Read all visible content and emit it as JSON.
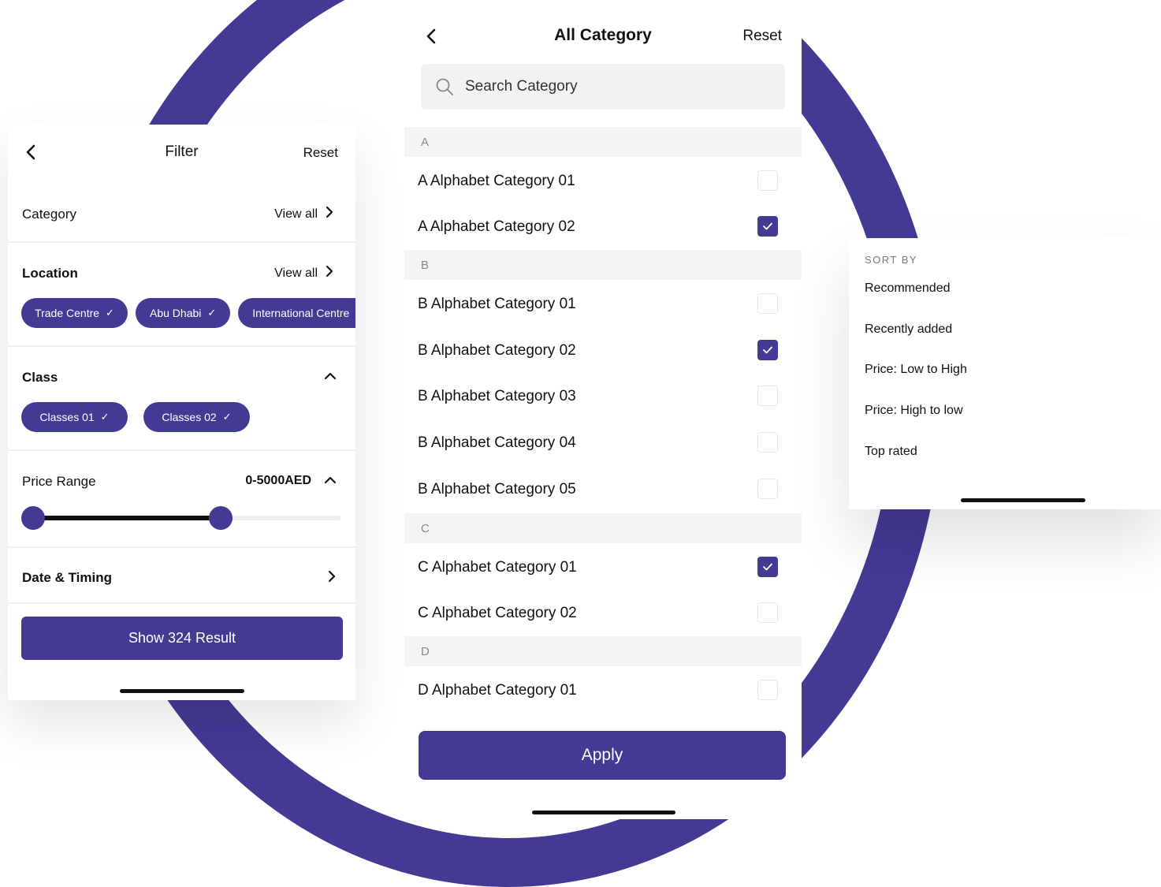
{
  "colors": {
    "accent": "#433a94",
    "text": "#111111",
    "muted": "#888888",
    "divider": "#f0f0f3"
  },
  "filter": {
    "title": "Filter",
    "reset": "Reset",
    "category": {
      "label": "Category",
      "view_all": "View all"
    },
    "location": {
      "label": "Location",
      "view_all": "View all",
      "chips": [
        "Trade Centre",
        "Abu Dhabi",
        "International Centre"
      ]
    },
    "class": {
      "label": "Class",
      "chips": [
        "Classes 01",
        "Classes 02"
      ]
    },
    "price": {
      "label": "Price Range",
      "value": "0-5000AED",
      "range_fraction": [
        0.0,
        0.61
      ]
    },
    "date": {
      "label": "Date & Timing"
    },
    "show_button": "Show 324 Result"
  },
  "category": {
    "title": "All Category",
    "reset": "Reset",
    "search_placeholder": "Search Category",
    "sections": [
      {
        "letter": "A",
        "items": [
          {
            "label": "A Alphabet Category 01",
            "checked": false
          },
          {
            "label": "A Alphabet Category 02",
            "checked": true
          }
        ]
      },
      {
        "letter": "B",
        "items": [
          {
            "label": "B Alphabet Category 01",
            "checked": false
          },
          {
            "label": "B Alphabet Category 02",
            "checked": true
          },
          {
            "label": "B Alphabet Category 03",
            "checked": false
          },
          {
            "label": "B Alphabet Category 04",
            "checked": false
          },
          {
            "label": "B Alphabet Category 05",
            "checked": false
          }
        ]
      },
      {
        "letter": "C",
        "items": [
          {
            "label": "C Alphabet Category 01",
            "checked": true
          },
          {
            "label": "C Alphabet Category 02",
            "checked": false
          }
        ]
      },
      {
        "letter": "D",
        "items": [
          {
            "label": "D Alphabet Category 01",
            "checked": false
          }
        ]
      }
    ],
    "apply_button": "Apply"
  },
  "sort": {
    "heading": "SORT BY",
    "options": [
      {
        "label": "Recommended",
        "selected": true
      },
      {
        "label": "Recently added",
        "selected": false
      },
      {
        "label": "Price: Low to High",
        "selected": false
      },
      {
        "label": "Price: High to low",
        "selected": false
      },
      {
        "label": "Top rated",
        "selected": false
      }
    ]
  }
}
